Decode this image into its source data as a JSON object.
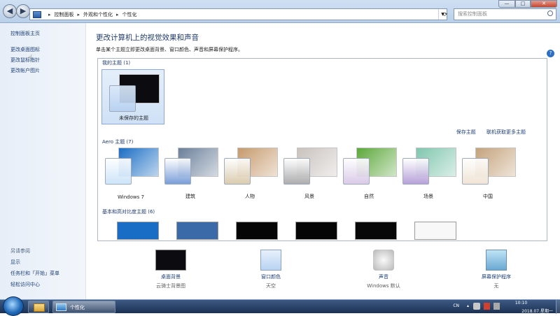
{
  "window": {
    "breadcrumb": [
      "控制面板",
      "外观和个性化",
      "个性化"
    ],
    "search_placeholder": "搜索控制面板",
    "caption": {
      "min": "—",
      "max": "□",
      "close": "✕"
    },
    "help": "?"
  },
  "sidebar": {
    "home": "控制面板主页",
    "items": [
      "更改桌面图标",
      "更改鼠标指针",
      "更改帐户图片"
    ],
    "see_also_header": "另请参阅",
    "see_also": [
      "显示",
      "任务栏和「开始」菜单",
      "轻松访问中心"
    ]
  },
  "main": {
    "title": "更改计算机上的视觉效果和声音",
    "subtitle": "单击某个主题立即更改桌面背景、窗口颜色、声音和屏幕保护程序。",
    "my_themes_header": "我的主题 (1)",
    "my_themes": [
      {
        "label": "未保存的主题"
      }
    ],
    "save_theme": "保存主题",
    "get_more": "联机获取更多主题",
    "aero_header": "Aero 主题 (7)",
    "aero_themes": [
      {
        "label": "Windows 7",
        "wall": "#1a6dc4",
        "glass": "#c9e2f9"
      },
      {
        "label": "建筑",
        "wall": "#6a7f9a",
        "glass": "#6f96d6"
      },
      {
        "label": "人物",
        "wall": "#c69a6d",
        "glass": "#d8c8a8"
      },
      {
        "label": "风景",
        "wall": "#c9c2bd",
        "glass": "#a6a6a6"
      },
      {
        "label": "自然",
        "wall": "#5ca73b",
        "glass": "#d7c6e6"
      },
      {
        "label": "场景",
        "wall": "#7fc6ad",
        "glass": "#b29ad7"
      },
      {
        "label": "中国",
        "wall": "#c4a27b",
        "glass": "#efe2d1"
      }
    ],
    "basic_header": "基本和高对比度主题 (6)",
    "basic_colors": [
      "#1a6dc4",
      "#3a6aa8",
      "#050505",
      "#050505",
      "#080808",
      "#f8f8f8"
    ],
    "bottom": [
      {
        "name": "桌面背景",
        "value": "云骑士背景图",
        "icon": "desktop-background-icon"
      },
      {
        "name": "窗口颜色",
        "value": "天空",
        "icon": "window-color-icon"
      },
      {
        "name": "声音",
        "value": "Windows 默认",
        "icon": "sound-icon"
      },
      {
        "name": "屏幕保护程序",
        "value": "无",
        "icon": "screensaver-icon"
      }
    ]
  },
  "taskbar": {
    "window_label": "个性化",
    "lang": "CN",
    "time": "10:10",
    "date": "2018.07.星期一"
  }
}
